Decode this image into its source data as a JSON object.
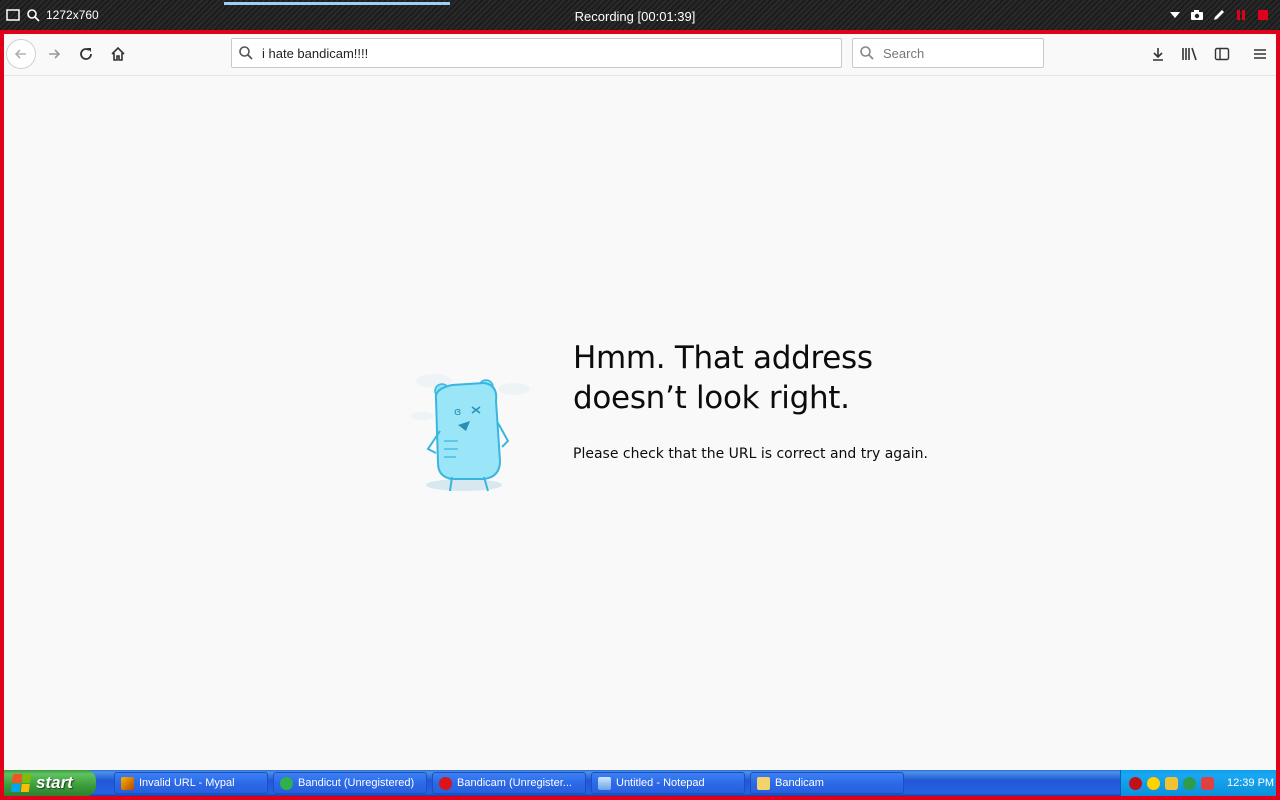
{
  "recorder": {
    "resolution": "1272x760",
    "title": "Recording [00:01:39]"
  },
  "browser": {
    "url_value": "i hate bandicam!!!!",
    "search_placeholder": "Search"
  },
  "error_page": {
    "title_line1": "Hmm. That address",
    "title_line2": "doesn’t look right.",
    "description": "Please check that the URL is correct and try again."
  },
  "taskbar": {
    "start_label": "start",
    "tasks": [
      {
        "label": "Invalid URL - Mypal",
        "icon": "mypal-icon"
      },
      {
        "label": "Bandicut (Unregistered)",
        "icon": "bandicut-icon"
      },
      {
        "label": "Bandicam (Unregister...",
        "icon": "bandicam-icon"
      },
      {
        "label": "Untitled - Notepad",
        "icon": "notepad-icon"
      },
      {
        "label": "Bandicam",
        "icon": "folder-icon"
      }
    ],
    "clock": "12:39 PM"
  },
  "colors": {
    "capture_border": "#e0001a",
    "taskbar_blue": "#2663e0",
    "start_green": "#3a9d3a",
    "tray_blue": "#0f9ff0"
  }
}
